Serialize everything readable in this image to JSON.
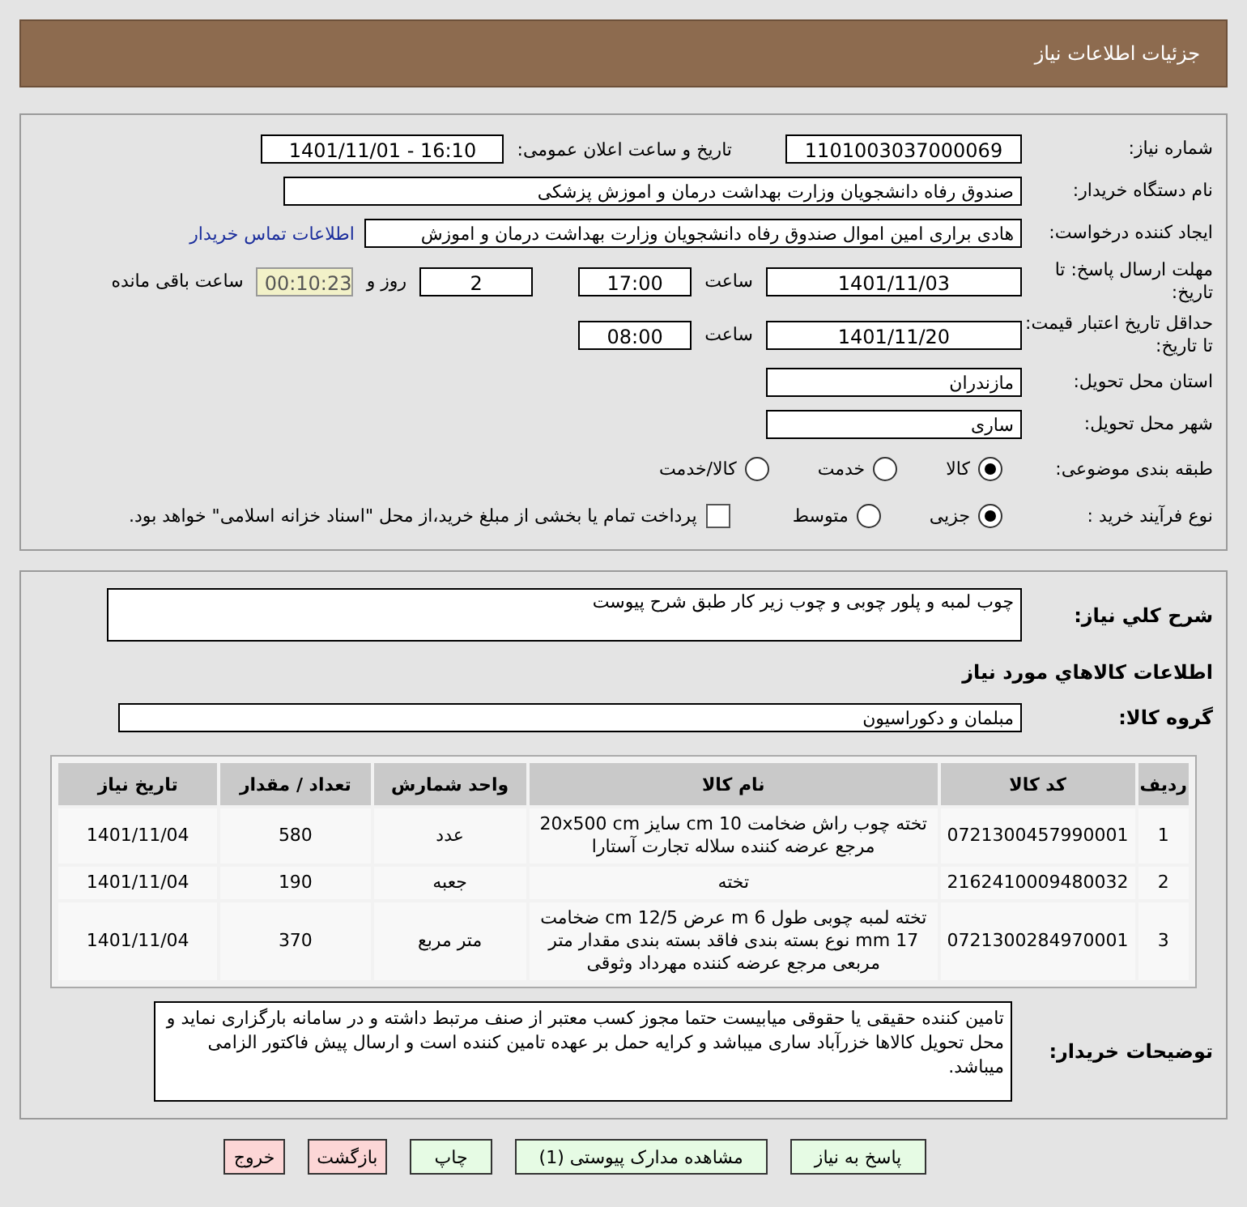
{
  "header": {
    "title": "جزئیات اطلاعات نیاز"
  },
  "need_info": {
    "need_number": {
      "label": "شماره نیاز:",
      "value": "1101003037000069"
    },
    "announce": {
      "label": "تاریخ و ساعت اعلان عمومی:",
      "value": "1401/11/01 - 16:10"
    },
    "buyer": {
      "label": "نام دستگاه خریدار:",
      "value": "صندوق رفاه دانشجویان وزارت بهداشت  درمان و اموزش پزشکی"
    },
    "requester": {
      "label": "ایجاد کننده درخواست:",
      "value": "هادی براری امین اموال صندوق رفاه دانشجویان وزارت بهداشت  درمان و اموزش",
      "link": "اطلاعات تماس خریدار"
    },
    "deadline": {
      "label": "مهلت ارسال پاسخ: تا تاریخ:",
      "date": "1401/11/03",
      "time_label": "ساعت",
      "time": "17:00",
      "days": "2",
      "days_label": "روز و",
      "remaining": "00:10:23",
      "remaining_label": "ساعت باقی مانده"
    },
    "validity": {
      "label": "حداقل تاریخ اعتبار قیمت: تا تاریخ:",
      "date": "1401/11/20",
      "time_label": "ساعت",
      "time": "08:00"
    },
    "province": {
      "label": "استان محل تحویل:",
      "value": "مازندران"
    },
    "city": {
      "label": "شهر محل تحویل:",
      "value": "ساری"
    },
    "category": {
      "label": "طبقه بندی موضوعی:",
      "options": [
        {
          "label": "کالا",
          "selected": true
        },
        {
          "label": "خدمت",
          "selected": false
        },
        {
          "label": "کالا/خدمت",
          "selected": false
        }
      ]
    },
    "purchase_type": {
      "label": "نوع فرآیند خرید :",
      "options": [
        {
          "label": "جزیی",
          "selected": true
        },
        {
          "label": "متوسط",
          "selected": false
        }
      ],
      "payment": {
        "checked": false,
        "label": "پرداخت تمام یا بخشی از مبلغ خرید،از محل \"اسناد خزانه اسلامی\" خواهد بود."
      }
    }
  },
  "goods": {
    "summary": {
      "label": "شرح کلي نياز:",
      "value": "چوب لمبه و پلور چوبی و چوب زیر کار طبق شرح پیوست"
    },
    "section_title": "اطلاعات کالاهاي مورد نياز",
    "group": {
      "label": "گروه کالا:",
      "value": "مبلمان و دکوراسیون"
    },
    "table": {
      "columns": [
        "ردیف",
        "کد کالا",
        "نام کالا",
        "واحد شمارش",
        "تعداد / مقدار",
        "تاریخ نیاز"
      ],
      "rows": [
        [
          "1",
          "0721300457990001",
          "تخته چوب راش ضخامت cm 10 سایز 20x500 cm مرجع عرضه کننده سلاله تجارت آستارا",
          "عدد",
          "580",
          "1401/11/04"
        ],
        [
          "2",
          "2162410009480032",
          "تخته",
          "جعبه",
          "190",
          "1401/11/04"
        ],
        [
          "3",
          "0721300284970001",
          "تخته لمبه چوبی طول m 6 عرض cm 12/5 ضخامت mm 17 نوع بسته بندی فاقد بسته بندی مقدار متر مربعی مرجع عرضه کننده مهرداد وثوقی",
          "متر مربع",
          "370",
          "1401/11/04"
        ]
      ]
    },
    "notes": {
      "label": "توضیحات خریدار:",
      "value": "تامین کننده حقیقی یا حقوقی میابیست حتما مجوز کسب معتبر از صنف مرتبط داشته و در سامانه بارگزاری نماید و محل تحویل کالاها خزرآباد ساری میباشد و کرایه حمل بر عهده تامین کننده است و ارسال پیش فاکتور الزامی میباشد."
    }
  },
  "buttons": [
    {
      "label": "پاسخ به نیاز",
      "kind": "normal"
    },
    {
      "label": "مشاهده مدارک پیوستی (1)",
      "kind": "normal"
    },
    {
      "label": "چاپ",
      "kind": "normal"
    },
    {
      "label": "بازگشت",
      "kind": "danger"
    },
    {
      "label": "خروج",
      "kind": "danger"
    }
  ]
}
